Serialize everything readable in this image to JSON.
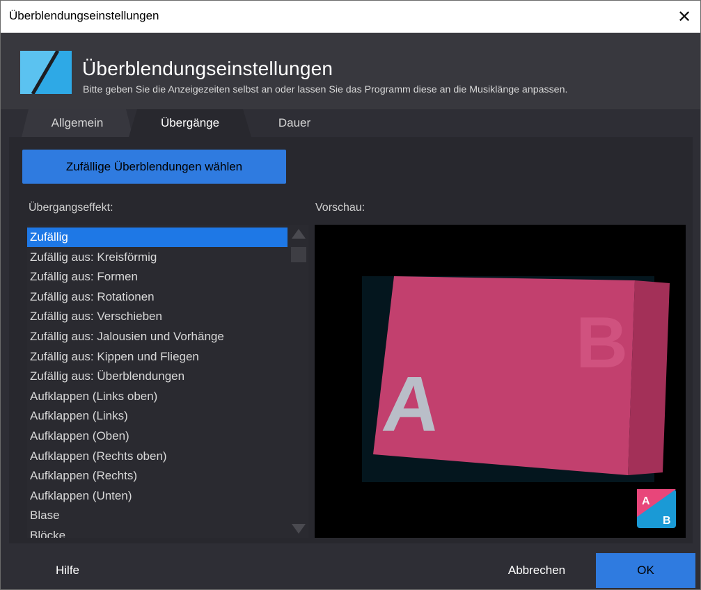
{
  "window": {
    "title": "Überblendungseinstellungen",
    "close_glyph": "✕"
  },
  "header": {
    "title": "Überblendungseinstellungen",
    "subtitle": "Bitte geben Sie die Anzeigezeiten selbst an oder lassen Sie das Programm diese an die Musiklänge anpassen.",
    "logo_icon": "transition-logo-icon"
  },
  "tabs": [
    {
      "label": "Allgemein",
      "active": false
    },
    {
      "label": "Übergänge",
      "active": true
    },
    {
      "label": "Dauer",
      "active": false
    }
  ],
  "random_button_label": "Zufällige Überblendungen wählen",
  "effect_label": "Übergangseffekt:",
  "preview_label": "Vorschau:",
  "effects": [
    "Zufällig",
    "Zufällig aus: Kreisförmig",
    "Zufällig aus: Formen",
    "Zufällig aus: Rotationen",
    "Zufällig aus: Verschieben",
    "Zufällig aus: Jalousien und Vorhänge",
    "Zufällig aus: Kippen und Fliegen",
    "Zufällig aus: Überblendungen",
    "Aufklappen (Links oben)",
    "Aufklappen (Links)",
    "Aufklappen (Oben)",
    "Aufklappen (Rechts oben)",
    "Aufklappen (Rechts)",
    "Aufklappen (Unten)",
    "Blase",
    "Blöcke"
  ],
  "selected_effect_index": 0,
  "preview": {
    "letter_a": "A",
    "letter_b": "B",
    "badge_a": "A",
    "badge_b": "B"
  },
  "footer": {
    "help_label": "Hilfe",
    "cancel_label": "Abbrechen",
    "ok_label": "OK"
  },
  "colors": {
    "accent": "#2f7be0",
    "selection": "#1e78e6",
    "card_pink": "#c2406e",
    "badge_pink": "#e8467a",
    "badge_blue": "#1a9ad6"
  }
}
